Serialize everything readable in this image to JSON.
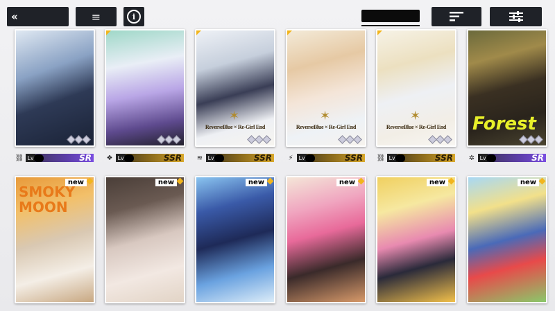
{
  "topbar": {
    "back_icon": "«",
    "menu_icon": "≡",
    "info_icon": "i"
  },
  "colors": {
    "accent_gold": "#f2b51c",
    "sr_purple": "#6a3ad0",
    "ssr_gold": "#c89a24",
    "button_dark": "#1f2228"
  },
  "cards_row1": [
    {
      "element_icon": "⛓",
      "level_prefix": "Lv",
      "rarity": "SR",
      "bar": "sr",
      "caption": ""
    },
    {
      "element_icon": "❖",
      "level_prefix": "Lv",
      "rarity": "SSR",
      "bar": "ssr",
      "caption": ""
    },
    {
      "element_icon": "≋",
      "level_prefix": "Lv",
      "rarity": "SSR",
      "bar": "ssr",
      "caption": "ReverseBlue × Re-Girl End"
    },
    {
      "element_icon": "⚡",
      "level_prefix": "Lv",
      "rarity": "SSR",
      "bar": "ssr",
      "caption": "ReverseBlue × Re-Girl End"
    },
    {
      "element_icon": "⛓",
      "level_prefix": "Lv",
      "rarity": "SSR",
      "bar": "ssr",
      "caption": "ReverseBlue × Re-Girl End"
    },
    {
      "element_icon": "✲",
      "level_prefix": "Lv",
      "rarity": "SR",
      "bar": "sr",
      "caption": "Forest"
    }
  ],
  "cards_row2": [
    {
      "new_label": "new",
      "text": "SMOKY MOON"
    },
    {
      "new_label": "new",
      "text": ""
    },
    {
      "new_label": "new",
      "text": ""
    },
    {
      "new_label": "new",
      "text": ""
    },
    {
      "new_label": "new",
      "text": ""
    },
    {
      "new_label": "new",
      "text": ""
    }
  ]
}
